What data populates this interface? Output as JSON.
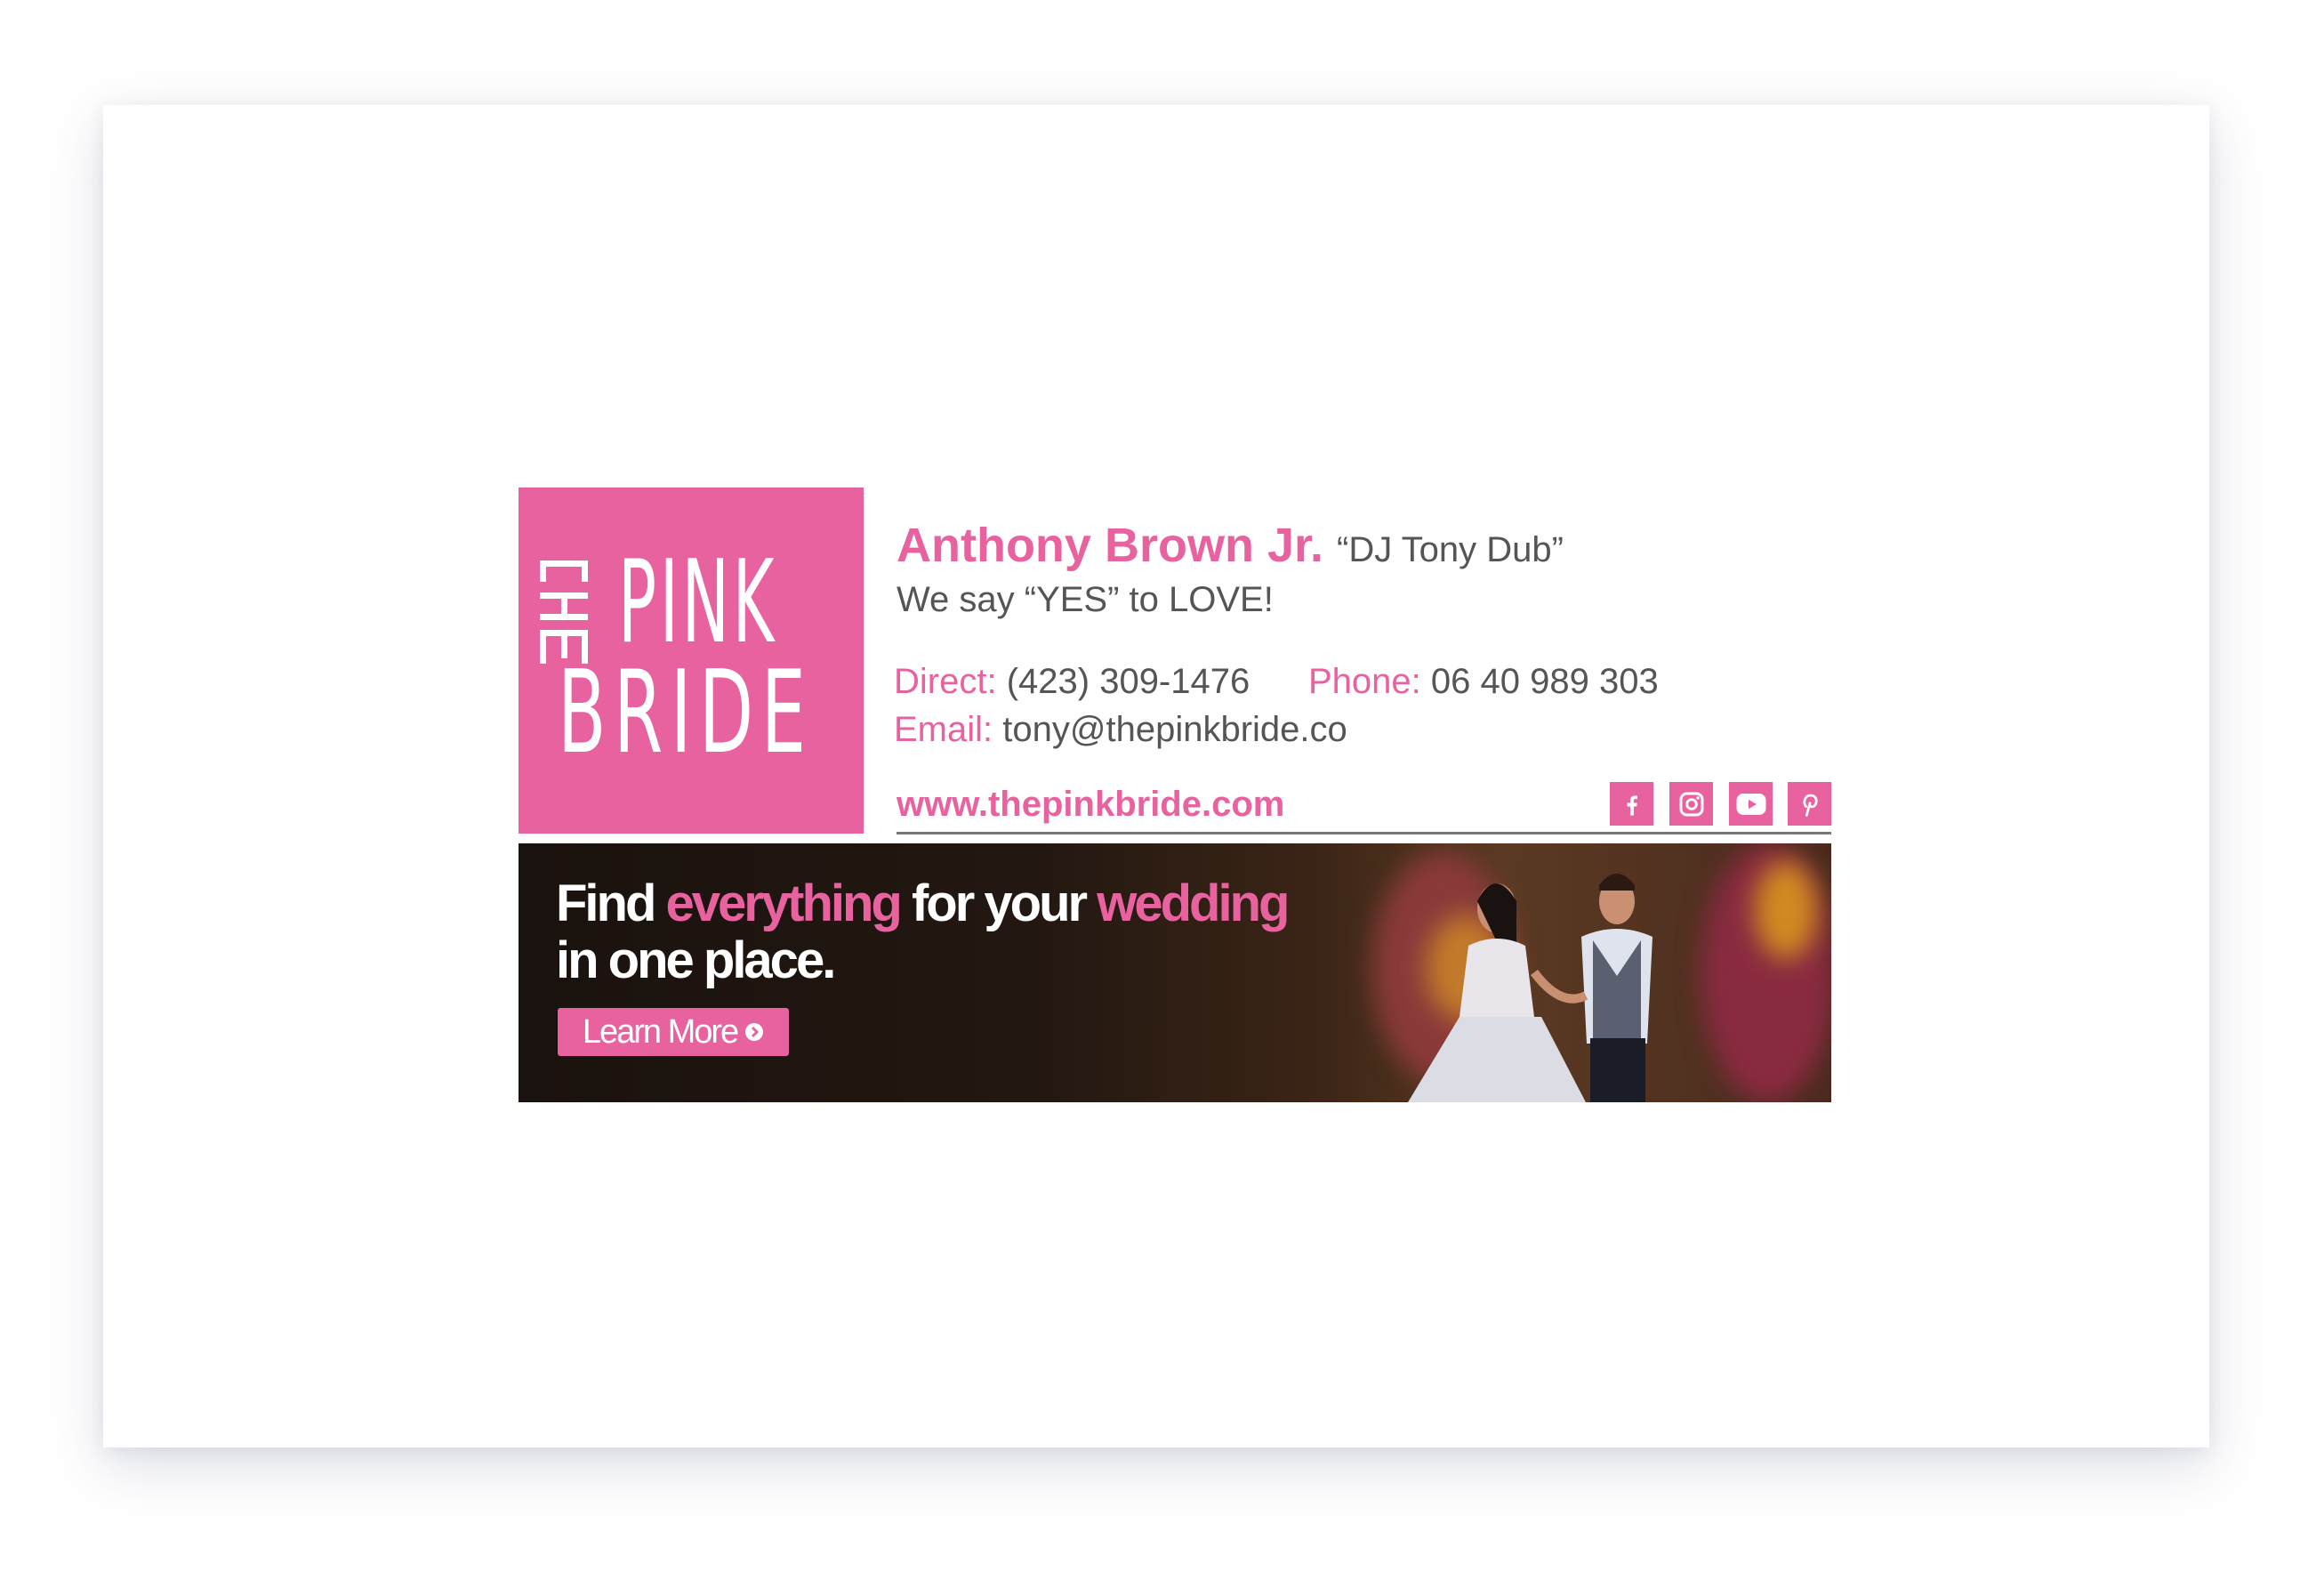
{
  "brand": {
    "logo_text": "THE PINK BRIDE",
    "accent": "#e8629f"
  },
  "signature": {
    "name": "Anthony Brown Jr.",
    "nickname": "“DJ Tony Dub”",
    "tagline": "We say “YES” to LOVE!",
    "direct_label": "Direct:",
    "direct_value": "(423) 309-1476",
    "phone_label": "Phone:",
    "phone_value": "06 40 989 303",
    "email_label": "Email:",
    "email_value": "tony@thepinkbride.co",
    "website": "www.thepinkbride.com",
    "social": [
      "facebook-icon",
      "instagram-icon",
      "youtube-icon",
      "pinterest-icon"
    ]
  },
  "banner": {
    "h1": "Find",
    "h2": "everything",
    "h3": "for your",
    "h4": "wedding",
    "h5": "in one place.",
    "cta": "Learn More"
  }
}
